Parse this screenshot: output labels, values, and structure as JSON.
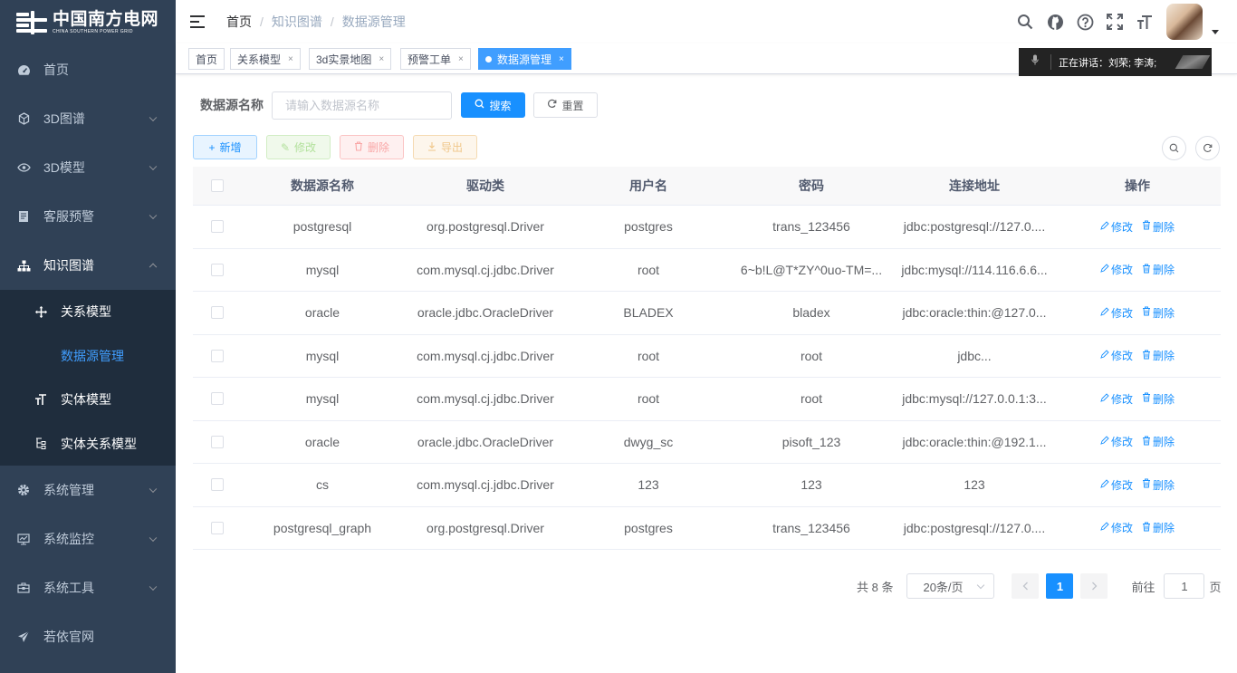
{
  "logo": {
    "title_cn": "中国南方电网",
    "title_en": "CHINA SOUTHERN POWER GRID"
  },
  "sidebar": {
    "items": [
      {
        "label": "首页",
        "icon": "dashboard-icon"
      },
      {
        "label": "3D图谱",
        "icon": "cube-icon"
      },
      {
        "label": "3D模型",
        "icon": "eye-icon"
      },
      {
        "label": "客服预警",
        "icon": "document-icon"
      },
      {
        "label": "知识图谱",
        "icon": "tree-icon"
      },
      {
        "label": "系统管理",
        "icon": "gear-icon"
      },
      {
        "label": "系统监控",
        "icon": "monitor-icon"
      },
      {
        "label": "系统工具",
        "icon": "toolbox-icon"
      },
      {
        "label": "若依官网",
        "icon": "send-icon"
      }
    ],
    "sub_items": [
      {
        "label": "关系模型",
        "icon": "move-icon"
      },
      {
        "label": "数据源管理",
        "icon": ""
      },
      {
        "label": "实体模型",
        "icon": "font-size-icon"
      },
      {
        "label": "实体关系模型",
        "icon": "list-tree-icon"
      }
    ]
  },
  "breadcrumb": [
    "首页",
    "知识图谱",
    "数据源管理"
  ],
  "tags": [
    {
      "label": "首页"
    },
    {
      "label": "关系模型"
    },
    {
      "label": "3d实景地图"
    },
    {
      "label": "预警工单"
    },
    {
      "label": "数据源管理"
    }
  ],
  "tag_close": "×",
  "voice": {
    "text": "正在讲话：刘荣; 李涛;"
  },
  "search": {
    "label": "数据源名称",
    "placeholder": "请输入数据源名称",
    "value": "",
    "search_btn": "搜索",
    "reset_btn": "重置"
  },
  "toolbar": {
    "add": "新增",
    "edit": "修改",
    "delete": "删除",
    "export": "导出"
  },
  "table": {
    "columns": [
      "数据源名称",
      "驱动类",
      "用户名",
      "密码",
      "连接地址",
      "操作"
    ],
    "rows": [
      [
        "postgresql",
        "org.postgresql.Driver",
        "postgres",
        "trans_123456",
        "jdbc:postgresql://127.0...."
      ],
      [
        "mysql",
        "com.mysql.cj.jdbc.Driver",
        "root",
        "6~b!L@T*ZY^0uo-TM=...",
        "jdbc:mysql://114.116.6.6..."
      ],
      [
        "oracle",
        "oracle.jdbc.OracleDriver",
        "BLADEX",
        "bladex",
        "jdbc:oracle:thin:@127.0..."
      ],
      [
        "mysql",
        "com.mysql.cj.jdbc.Driver",
        "root",
        "root",
        "jdbc..."
      ],
      [
        "mysql",
        "com.mysql.cj.jdbc.Driver",
        "root",
        "root",
        "jdbc:mysql://127.0.0.1:3..."
      ],
      [
        "oracle",
        "oracle.jdbc.OracleDriver",
        "dwyg_sc",
        "pisoft_123",
        "jdbc:oracle:thin:@192.1..."
      ],
      [
        "cs",
        "com.mysql.cj.jdbc.Driver",
        "123",
        "123",
        "123"
      ],
      [
        "postgresql_graph",
        "org.postgresql.Driver",
        "postgres",
        "trans_123456",
        "jdbc:postgresql://127.0...."
      ]
    ],
    "op_edit": "修改",
    "op_delete": "删除"
  },
  "pagination": {
    "total": "共 8 条",
    "page_size": "20条/页",
    "current": "1",
    "goto_label": "前往",
    "goto_value": "1",
    "page_suffix": "页"
  },
  "colors": {
    "sidebar_bg": "#304156",
    "submenu_bg": "#1f2d3d",
    "primary": "#1890ff",
    "active_text": "#409eff"
  }
}
